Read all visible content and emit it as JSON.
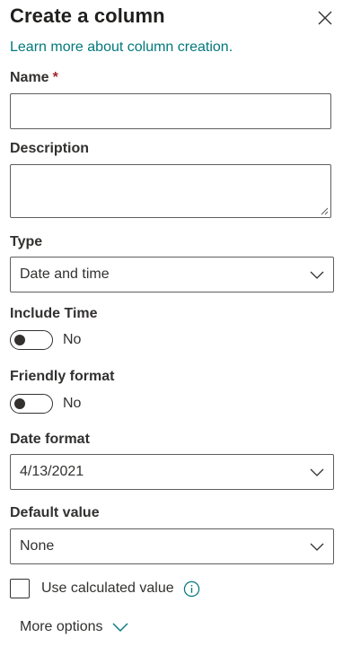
{
  "panel": {
    "title": "Create a column",
    "learn_more_link": "Learn more about column creation."
  },
  "name_field": {
    "label": "Name",
    "required_marker": "*",
    "value": "",
    "placeholder": ""
  },
  "description_field": {
    "label": "Description",
    "value": "",
    "placeholder": ""
  },
  "type_field": {
    "label": "Type",
    "selected": "Date and time"
  },
  "include_time": {
    "label": "Include Time",
    "state_text": "No",
    "on": false
  },
  "friendly_format": {
    "label": "Friendly format",
    "state_text": "No",
    "on": false
  },
  "date_format": {
    "label": "Date format",
    "selected": "4/13/2021"
  },
  "default_value": {
    "label": "Default value",
    "selected": "None"
  },
  "calculated_value": {
    "label": "Use calculated value",
    "checked": false
  },
  "more_options": {
    "label": "More options"
  },
  "icons": {
    "close": "close-icon",
    "chevron": "chevron-down-icon",
    "info": "info-icon"
  },
  "colors": {
    "link": "#03787c",
    "text": "#323130",
    "required": "#a4262c",
    "border": "#605e5c"
  }
}
